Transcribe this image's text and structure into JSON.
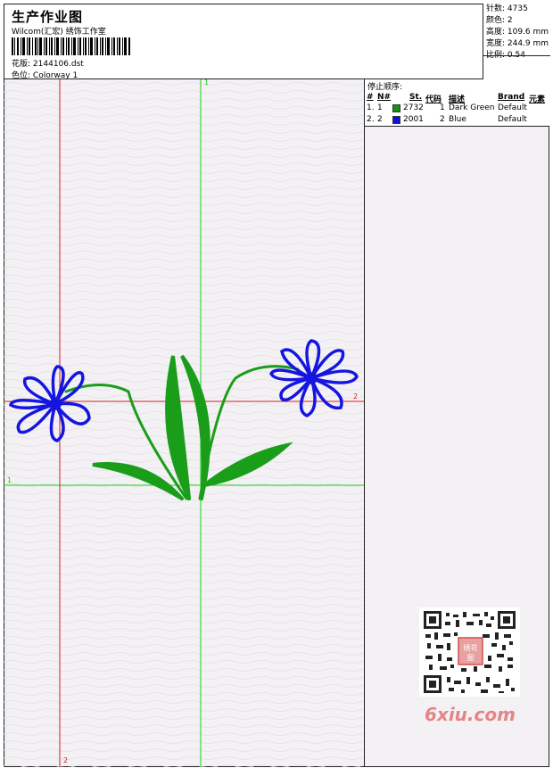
{
  "header": {
    "title": "生产作业图",
    "subtitle": "Wilcom(汇宏) 绣饰工作室",
    "design_label": "花版:",
    "design_value": "2144106.dst",
    "colorway_label": "色位:",
    "colorway_value": "Colorway 1"
  },
  "stats": {
    "stitches": "针数: 4735",
    "colors": "颜色: 2",
    "height": "高度: 109.6 mm",
    "width": "宽度: 244.9 mm",
    "scale": "比例: 0.54"
  },
  "stop_sequence": {
    "title": "停止顺序:",
    "columns": [
      "#",
      "N#",
      "St.",
      "代码",
      "描述",
      "Brand",
      "元素"
    ],
    "rows": [
      {
        "idx": "1.",
        "n": "1",
        "color": "#1a8f1a",
        "st": "2732",
        "code": "1",
        "desc": "Dark Green",
        "brand": "Default"
      },
      {
        "idx": "2.",
        "n": "2",
        "color": "#1010e0",
        "st": "2001",
        "code": "2",
        "desc": "Blue",
        "brand": "Default"
      }
    ]
  },
  "guides": {
    "green_v_label": "1",
    "green_h_label": "1",
    "red_v_label": "2",
    "red_h_label": "2",
    "green_color": "#16d316",
    "red_color": "#d42020"
  },
  "watermark": {
    "text": "6xiu.com",
    "seal": "绣花图"
  }
}
